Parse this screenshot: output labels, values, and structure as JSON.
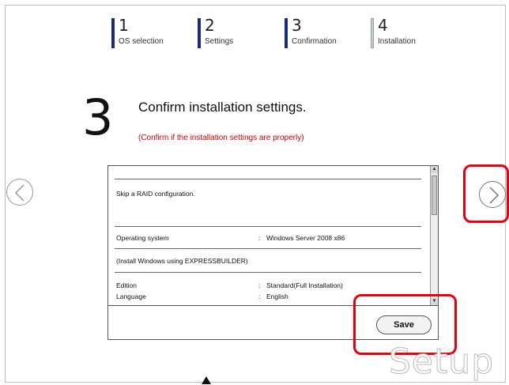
{
  "steps": [
    {
      "num": "1",
      "label": "OS selection"
    },
    {
      "num": "2",
      "label": "Settings"
    },
    {
      "num": "3",
      "label": "Confirmation"
    },
    {
      "num": "4",
      "label": "Installation"
    }
  ],
  "current_step_number": "3",
  "title": "Confirm installation settings.",
  "subtitle": "(Confirm if the installation settings are properly)",
  "summary": {
    "raid": "Skip a RAID configuration.",
    "os_label": "Operating system",
    "os_value": "Windows Server 2008 x86",
    "note": "(Install Windows using EXPRESSBUILDER)",
    "edition_label": "Edition",
    "edition_value": "Standard(Full Installation)",
    "language_label": "Language",
    "language_value": "English",
    "separator": ":"
  },
  "buttons": {
    "save": "Save"
  },
  "nav": {
    "prev_icon": "chevron-left-circle-icon",
    "next_icon": "chevron-right-circle-icon"
  },
  "watermark": "Setup",
  "colors": {
    "highlight": "#e4000f",
    "subtitle": "#d00000",
    "step_bar": "#1a2a80"
  }
}
